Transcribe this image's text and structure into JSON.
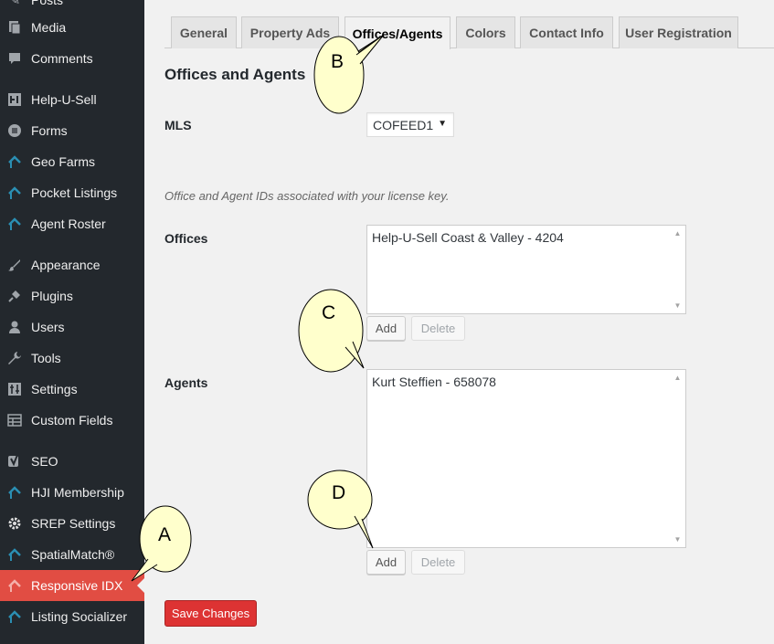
{
  "sidebar": {
    "items": [
      {
        "label": "Posts",
        "icon": "pushpin-icon"
      },
      {
        "label": "Media",
        "icon": "media-icon"
      },
      {
        "label": "Comments",
        "icon": "comment-icon"
      },
      {
        "label": "Help-U-Sell",
        "icon": "plugin-icon"
      },
      {
        "label": "Forms",
        "icon": "forms-icon"
      },
      {
        "label": "Geo Farms",
        "icon": "house-icon"
      },
      {
        "label": "Pocket Listings",
        "icon": "house-icon"
      },
      {
        "label": "Agent Roster",
        "icon": "house-icon"
      },
      {
        "label": "Appearance",
        "icon": "brush-icon"
      },
      {
        "label": "Plugins",
        "icon": "plug-icon"
      },
      {
        "label": "Users",
        "icon": "user-icon"
      },
      {
        "label": "Tools",
        "icon": "wrench-icon"
      },
      {
        "label": "Settings",
        "icon": "settings-icon"
      },
      {
        "label": "Custom Fields",
        "icon": "table-icon"
      },
      {
        "label": "SEO",
        "icon": "yoast-icon"
      },
      {
        "label": "HJI Membership",
        "icon": "house-icon"
      },
      {
        "label": "SREP Settings",
        "icon": "gear-icon"
      },
      {
        "label": "SpatialMatch®",
        "icon": "house-icon"
      },
      {
        "label": "Responsive IDX",
        "icon": "house-icon",
        "active": true
      },
      {
        "label": "Listing Socializer",
        "icon": "house-icon"
      }
    ],
    "active_color": "#dd3333"
  },
  "tabs": [
    "General",
    "Property Ads",
    "Offices/Agents",
    "Colors",
    "Contact Info",
    "User Registration"
  ],
  "active_tab": "Offices/Agents",
  "page_title": "Offices and Agents",
  "mls": {
    "label": "MLS",
    "value": "COFEED1"
  },
  "description": "Office and Agent IDs associated with your license key.",
  "offices": {
    "label": "Offices",
    "entries": [
      "Help-U-Sell Coast & Valley - 4204"
    ],
    "add_label": "Add",
    "delete_label": "Delete"
  },
  "agents": {
    "label": "Agents",
    "entries": [
      "Kurt Steffien - 658078"
    ],
    "add_label": "Add",
    "delete_label": "Delete"
  },
  "save_label": "Save Changes",
  "callouts": {
    "a": "A",
    "b": "B",
    "c": "C",
    "d": "D"
  }
}
